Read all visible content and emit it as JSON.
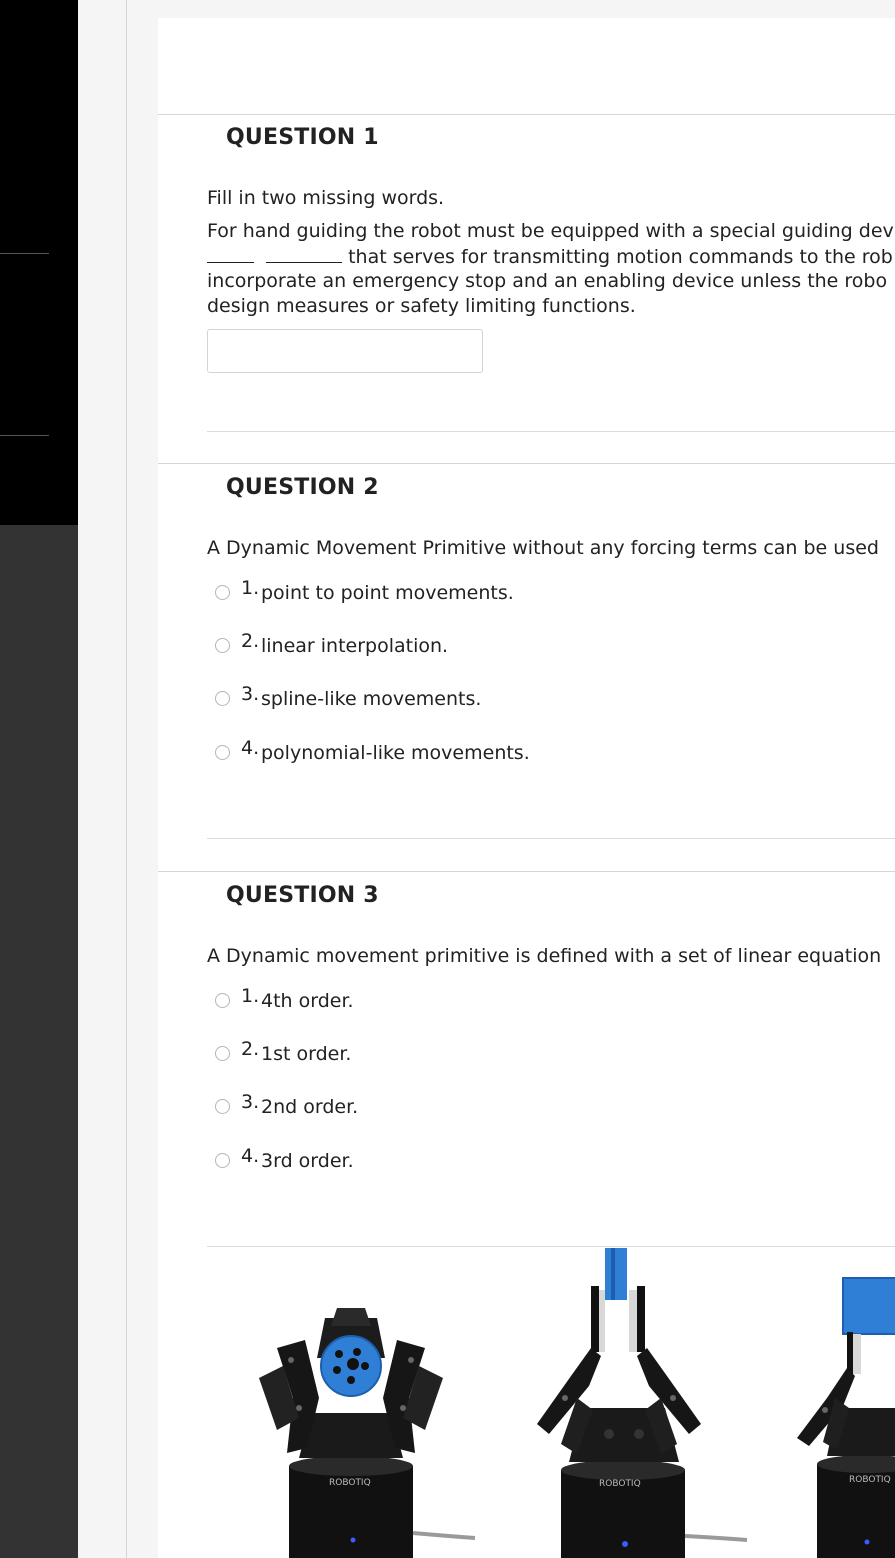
{
  "questions": [
    {
      "title": "QUESTION 1",
      "intro": "Fill in two missing words.",
      "line1": "For hand guiding the robot must be equipped with a special guiding dev",
      "line2_after_blanks": "that serves for transmitting motion commands to the rob",
      "line3": "incorporate an emergency stop and an enabling device unless the robo",
      "line4": "design measures or safety limiting functions.",
      "answer_value": ""
    },
    {
      "title": "QUESTION 2",
      "prompt": "A Dynamic Movement Primitive without any forcing terms can be used",
      "options": [
        {
          "num": "1.",
          "text": "point to point movements."
        },
        {
          "num": "2.",
          "text": "linear interpolation."
        },
        {
          "num": "3.",
          "text": "spline-like movements."
        },
        {
          "num": "4.",
          "text": "polynomial-like movements."
        }
      ]
    },
    {
      "title": "QUESTION 3",
      "prompt": "A Dynamic movement primitive is defined with a set of linear equation",
      "options": [
        {
          "num": "1.",
          "text": "4th order."
        },
        {
          "num": "2.",
          "text": "1st order."
        },
        {
          "num": "3.",
          "text": "2nd order."
        },
        {
          "num": "4.",
          "text": "3rd order."
        }
      ]
    }
  ],
  "gripper_images": [
    {
      "logo": "ROBOTIQ",
      "kind": "three-finger-gripper-top"
    },
    {
      "logo": "ROBOTIQ",
      "kind": "three-finger-gripper-open"
    },
    {
      "logo": "ROBOTIQ",
      "kind": "three-finger-gripper-blue-block"
    }
  ],
  "colors": {
    "rail_top": "#000000",
    "rail_bottom": "#333333",
    "sheet": "#ffffff",
    "text": "#222222",
    "gripper_blue": "#2f7fd6"
  }
}
